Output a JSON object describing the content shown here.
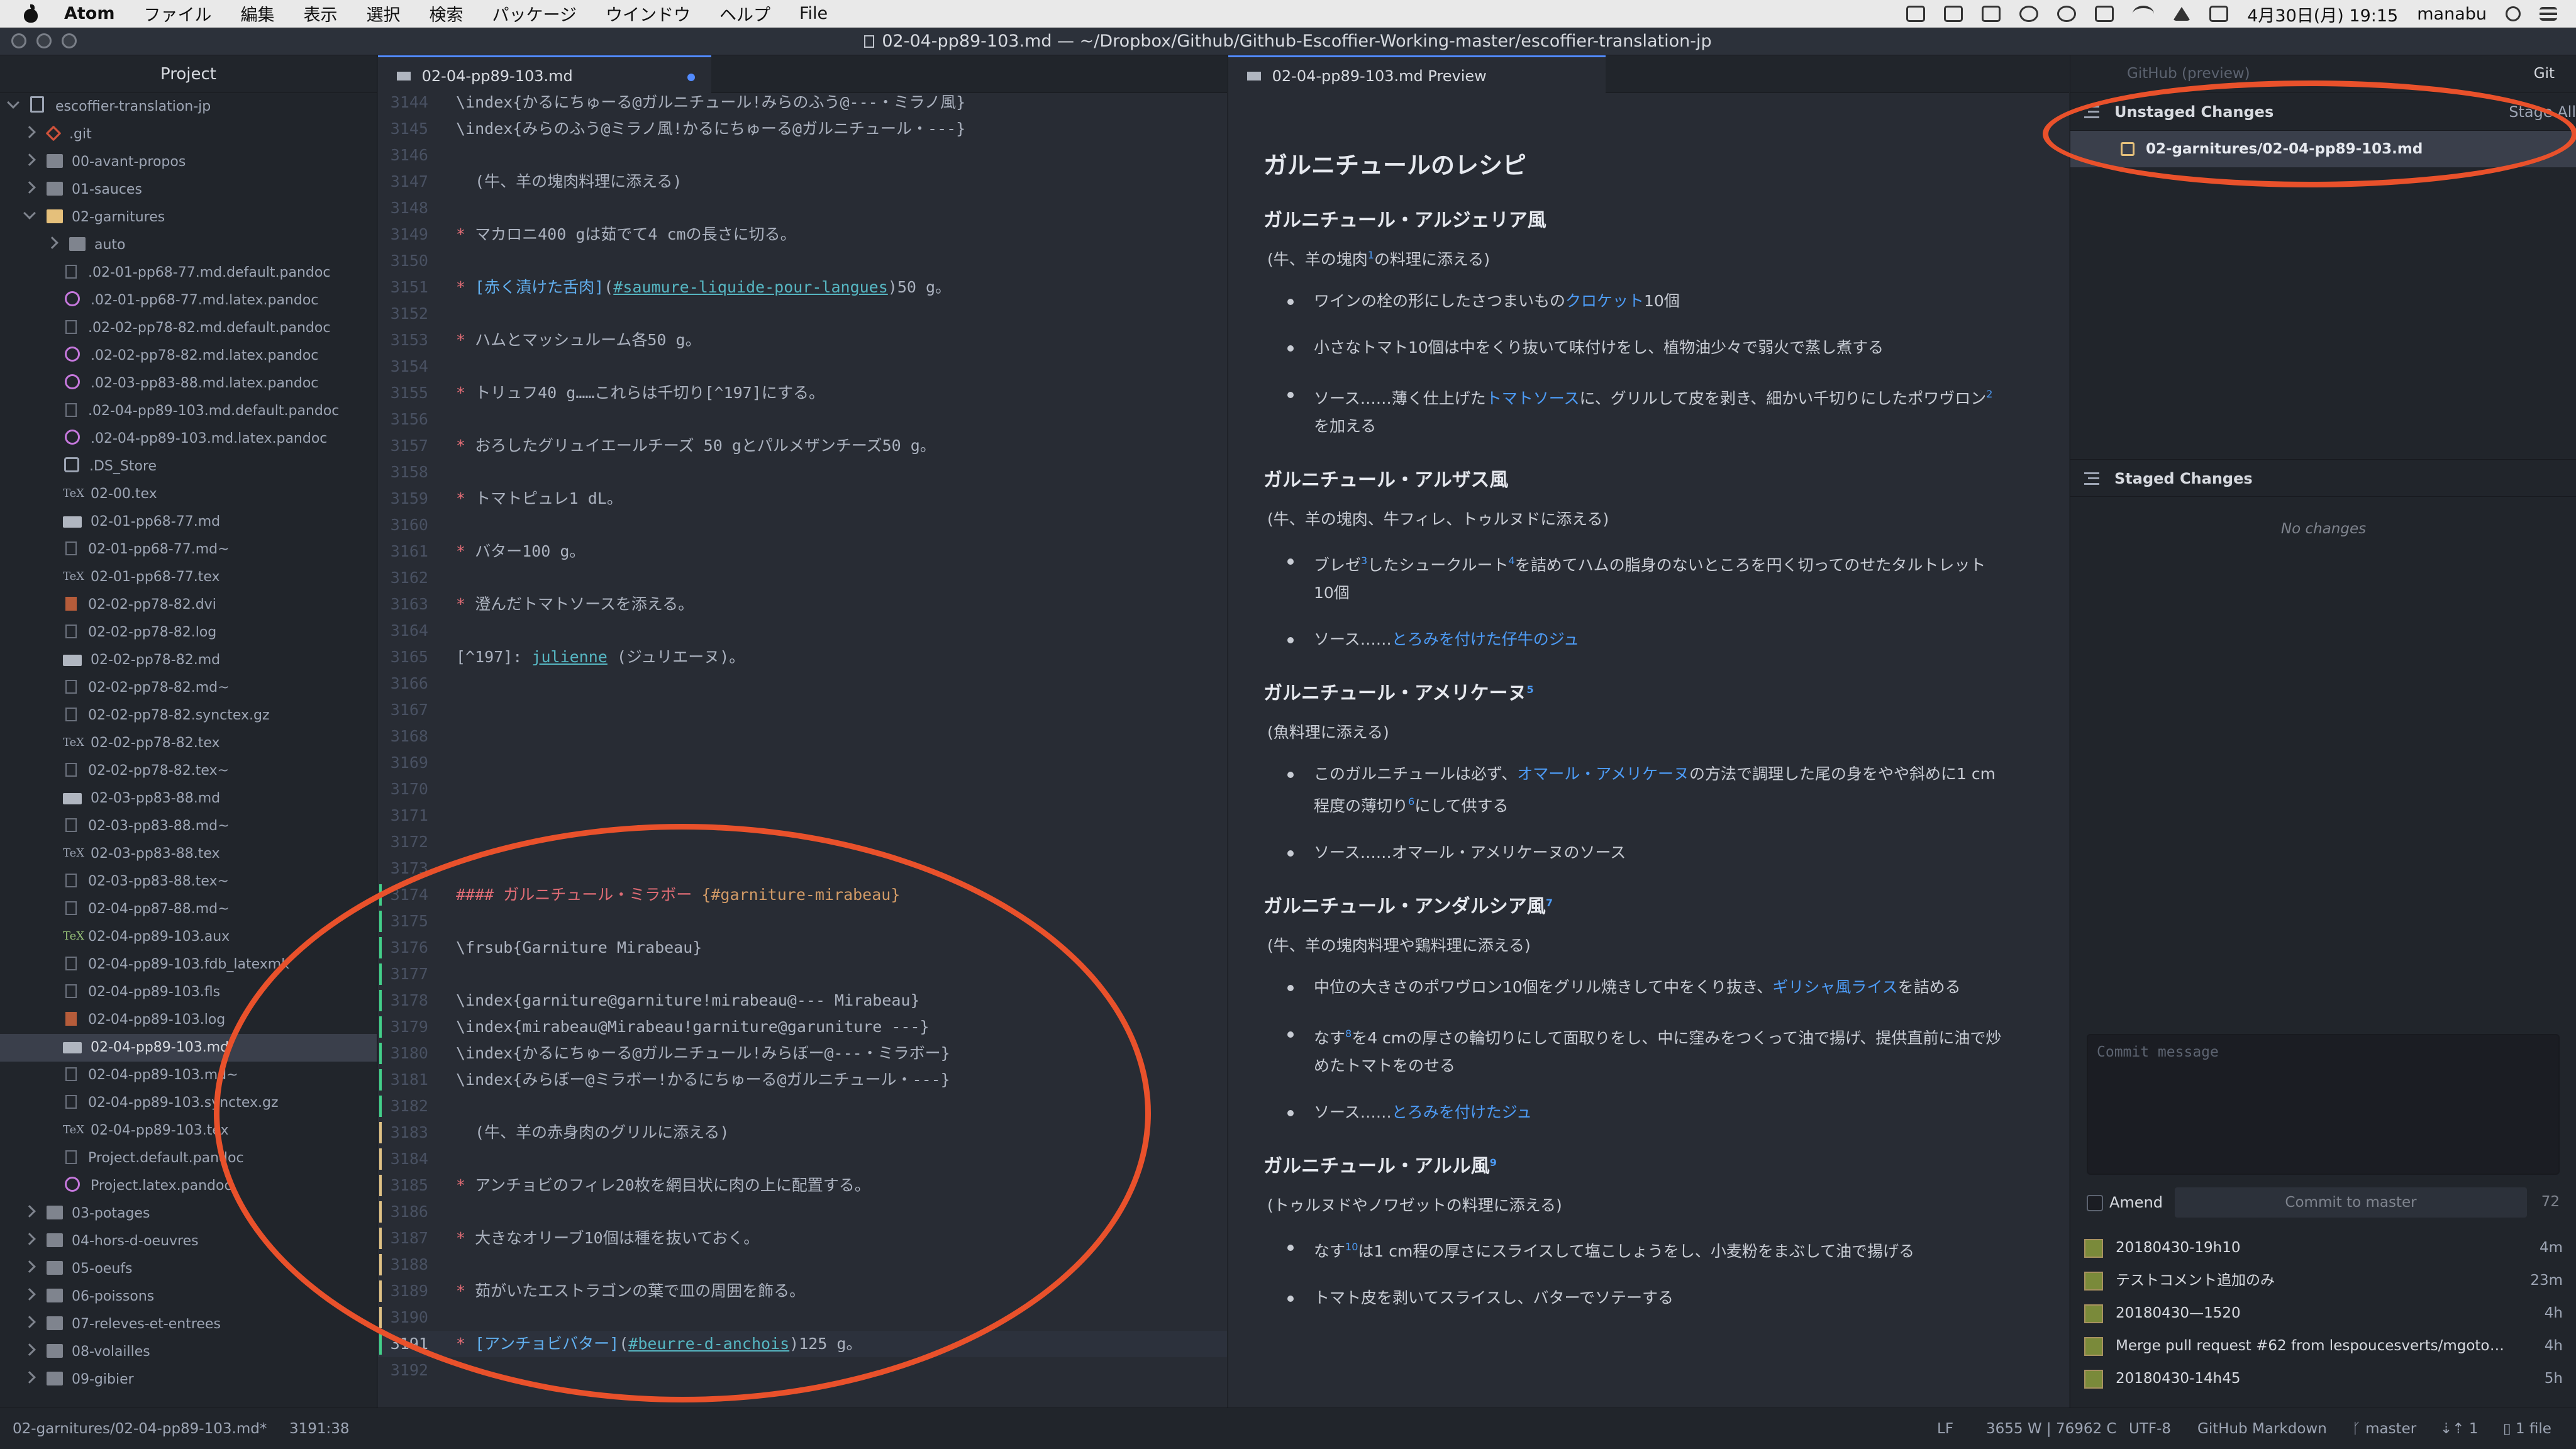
{
  "menubar": {
    "app": "Atom",
    "items": [
      "ファイル",
      "編集",
      "表示",
      "選択",
      "検索",
      "パッケージ",
      "ウインドウ",
      "ヘルプ",
      "File"
    ],
    "datetime": "4月30日(月)  19:15",
    "user": "manabu"
  },
  "window": {
    "title": "02-04-pp89-103.md — ~/Dropbox/Github/Github-Escoffier-Working-master/escoffier-translation-jp"
  },
  "tree": {
    "title": "Project",
    "items": [
      {
        "label": "escoffier-translation-jp",
        "kind": "root",
        "depth": 0,
        "chev": "open"
      },
      {
        "label": ".git",
        "kind": "git",
        "depth": 1,
        "chev": "closed"
      },
      {
        "label": "00-avant-propos",
        "kind": "folder",
        "depth": 1,
        "chev": "closed"
      },
      {
        "label": "01-sauces",
        "kind": "folder",
        "depth": 1,
        "chev": "closed"
      },
      {
        "label": "02-garnitures",
        "kind": "folder-open",
        "depth": 1,
        "chev": "open"
      },
      {
        "label": "auto",
        "kind": "folder",
        "depth": 2,
        "chev": "closed"
      },
      {
        "label": ".02-01-pp68-77.md.default.pandoc",
        "kind": "file",
        "depth": 2
      },
      {
        "label": ".02-01-pp68-77.md.latex.pandoc",
        "kind": "pandoc",
        "depth": 2
      },
      {
        "label": ".02-02-pp78-82.md.default.pandoc",
        "kind": "file",
        "depth": 2
      },
      {
        "label": ".02-02-pp78-82.md.latex.pandoc",
        "kind": "pandoc",
        "depth": 2
      },
      {
        "label": ".02-03-pp83-88.md.latex.pandoc",
        "kind": "pandoc",
        "depth": 2
      },
      {
        "label": ".02-04-pp89-103.md.default.pandoc",
        "kind": "file",
        "depth": 2
      },
      {
        "label": ".02-04-pp89-103.md.latex.pandoc",
        "kind": "pandoc",
        "depth": 2
      },
      {
        "label": ".DS_Store",
        "kind": "dsstore",
        "depth": 2
      },
      {
        "label": "02-00.tex",
        "kind": "tex",
        "depth": 2
      },
      {
        "label": "02-01-pp68-77.md",
        "kind": "md",
        "depth": 2
      },
      {
        "label": "02-01-pp68-77.md~",
        "kind": "file",
        "depth": 2
      },
      {
        "label": "02-01-pp68-77.tex",
        "kind": "tex",
        "depth": 2
      },
      {
        "label": "02-02-pp78-82.dvi",
        "kind": "log",
        "depth": 2
      },
      {
        "label": "02-02-pp78-82.log",
        "kind": "file",
        "depth": 2
      },
      {
        "label": "02-02-pp78-82.md",
        "kind": "md",
        "depth": 2
      },
      {
        "label": "02-02-pp78-82.md~",
        "kind": "file",
        "depth": 2
      },
      {
        "label": "02-02-pp78-82.synctex.gz",
        "kind": "file",
        "depth": 2
      },
      {
        "label": "02-02-pp78-82.tex",
        "kind": "tex",
        "depth": 2
      },
      {
        "label": "02-02-pp78-82.tex~",
        "kind": "file",
        "depth": 2
      },
      {
        "label": "02-03-pp83-88.md",
        "kind": "md",
        "depth": 2
      },
      {
        "label": "02-03-pp83-88.md~",
        "kind": "file",
        "depth": 2
      },
      {
        "label": "02-03-pp83-88.tex",
        "kind": "tex",
        "depth": 2
      },
      {
        "label": "02-03-pp83-88.tex~",
        "kind": "file",
        "depth": 2
      },
      {
        "label": "02-04-pp87-88.md~",
        "kind": "file",
        "depth": 2
      },
      {
        "label": "02-04-pp89-103.aux",
        "kind": "aux",
        "depth": 2
      },
      {
        "label": "02-04-pp89-103.fdb_latexmk",
        "kind": "file",
        "depth": 2
      },
      {
        "label": "02-04-pp89-103.fls",
        "kind": "file",
        "depth": 2
      },
      {
        "label": "02-04-pp89-103.log",
        "kind": "log",
        "depth": 2
      },
      {
        "label": "02-04-pp89-103.md",
        "kind": "md",
        "depth": 2,
        "selected": true
      },
      {
        "label": "02-04-pp89-103.md~",
        "kind": "file",
        "depth": 2
      },
      {
        "label": "02-04-pp89-103.synctex.gz",
        "kind": "file",
        "depth": 2
      },
      {
        "label": "02-04-pp89-103.tex",
        "kind": "tex",
        "depth": 2
      },
      {
        "label": "Project.default.pandoc",
        "kind": "file",
        "depth": 2
      },
      {
        "label": "Project.latex.pandoc",
        "kind": "pandoc",
        "depth": 2
      },
      {
        "label": "03-potages",
        "kind": "folder",
        "depth": 1,
        "chev": "closed"
      },
      {
        "label": "04-hors-d-oeuvres",
        "kind": "folder",
        "depth": 1,
        "chev": "closed"
      },
      {
        "label": "05-oeufs",
        "kind": "folder",
        "depth": 1,
        "chev": "closed"
      },
      {
        "label": "06-poissons",
        "kind": "folder",
        "depth": 1,
        "chev": "closed"
      },
      {
        "label": "07-releves-et-entrees",
        "kind": "folder",
        "depth": 1,
        "chev": "closed"
      },
      {
        "label": "08-volailles",
        "kind": "folder",
        "depth": 1,
        "chev": "closed"
      },
      {
        "label": "09-gibier",
        "kind": "folder",
        "depth": 1,
        "chev": "closed"
      }
    ]
  },
  "editor": {
    "tab_label": "02-04-pp89-103.md",
    "lines": [
      {
        "n": "3144",
        "text": "\\index{かるにちゅーる@ガルニチュール!みらのふう@---・ミラノ風}"
      },
      {
        "n": "3145",
        "text": "\\index{みらのふう@ミラノ風!かるにちゅーる@ガルニチュール・---}"
      },
      {
        "n": "3146",
        "text": ""
      },
      {
        "n": "3147",
        "text": "  (牛、羊の塊肉料理に添える)"
      },
      {
        "n": "3148",
        "text": ""
      },
      {
        "n": "3149",
        "text": "マカロニ400 gは茹でて4 cmの長さに切る。",
        "bullet": true
      },
      {
        "n": "3150",
        "text": ""
      },
      {
        "n": "3151",
        "bullet": true,
        "parts": [
          [
            "link",
            "[赤く漬けた舌肉]"
          ],
          [
            "plain",
            "("
          ],
          [
            "url",
            "#saumure-liquide-pour-langues"
          ],
          [
            "plain",
            ")50 g。"
          ]
        ]
      },
      {
        "n": "3152",
        "text": ""
      },
      {
        "n": "3153",
        "text": "ハムとマッシュルーム各50 g。",
        "bullet": true
      },
      {
        "n": "3154",
        "text": ""
      },
      {
        "n": "3155",
        "text": "トリュフ40 g……これらは千切り[^197]にする。",
        "bullet": true
      },
      {
        "n": "3156",
        "text": ""
      },
      {
        "n": "3157",
        "text": "おろしたグリュイエールチーズ 50 gとパルメザンチーズ50 g。",
        "bullet": true
      },
      {
        "n": "3158",
        "text": ""
      },
      {
        "n": "3159",
        "text": "トマトピュレ1 dL。",
        "bullet": true
      },
      {
        "n": "3160",
        "text": ""
      },
      {
        "n": "3161",
        "text": "バター100 g。",
        "bullet": true
      },
      {
        "n": "3162",
        "text": ""
      },
      {
        "n": "3163",
        "text": "澄んだトマトソースを添える。",
        "bullet": true
      },
      {
        "n": "3164",
        "text": ""
      },
      {
        "n": "3165",
        "parts": [
          [
            "plain",
            "[^197]: "
          ],
          [
            "url",
            "julienne"
          ],
          [
            "plain",
            " (ジュリエーヌ)。"
          ]
        ]
      },
      {
        "n": "3166",
        "text": ""
      },
      {
        "n": "3167",
        "text": ""
      },
      {
        "n": "3168",
        "text": ""
      },
      {
        "n": "3169",
        "text": ""
      },
      {
        "n": "3170",
        "text": ""
      },
      {
        "n": "3171",
        "text": ""
      },
      {
        "n": "3172",
        "text": ""
      },
      {
        "n": "3173",
        "text": ""
      },
      {
        "n": "3174",
        "parts": [
          [
            "head",
            "#### ガルニチュール・ミラボー "
          ],
          [
            "anchor",
            "{#garniture-mirabeau}"
          ]
        ],
        "mark": "added"
      },
      {
        "n": "3175",
        "text": "",
        "mark": "added"
      },
      {
        "n": "3176",
        "text": "\\frsub{Garniture Mirabeau}",
        "mark": "added"
      },
      {
        "n": "3177",
        "text": "",
        "mark": "added"
      },
      {
        "n": "3178",
        "text": "\\index{garniture@garniture!mirabeau@--- Mirabeau}",
        "mark": "added"
      },
      {
        "n": "3179",
        "text": "\\index{mirabeau@Mirabeau!garniture@garuniture ---}",
        "mark": "added"
      },
      {
        "n": "3180",
        "text": "\\index{かるにちゅーる@ガルニチュール!みらぼー@---・ミラボー}",
        "mark": "added"
      },
      {
        "n": "3181",
        "text": "\\index{みらぼー@ミラボー!かるにちゅーる@ガルニチュール・---}",
        "mark": "added"
      },
      {
        "n": "3182",
        "text": "",
        "mark": "added"
      },
      {
        "n": "3183",
        "text": "  (牛、羊の赤身肉のグリルに添える)",
        "mark": "modified"
      },
      {
        "n": "3184",
        "text": "",
        "mark": "modified"
      },
      {
        "n": "3185",
        "text": "アンチョビのフィレ20枚を網目状に肉の上に配置する。",
        "bullet": true,
        "mark": "modified"
      },
      {
        "n": "3186",
        "text": "",
        "mark": "modified"
      },
      {
        "n": "3187",
        "text": "大きなオリーブ10個は種を抜いておく。",
        "bullet": true,
        "mark": "modified"
      },
      {
        "n": "3188",
        "text": "",
        "mark": "modified"
      },
      {
        "n": "3189",
        "text": "茹がいたエストラゴンの葉で皿の周囲を飾る。",
        "bullet": true,
        "mark": "modified"
      },
      {
        "n": "3190",
        "text": "",
        "mark": "modified"
      },
      {
        "n": "3191",
        "bullet": true,
        "cursor": true,
        "mark": "added",
        "parts": [
          [
            "link",
            "[アンチョビバター]"
          ],
          [
            "plain",
            "("
          ],
          [
            "url",
            "#beurre-d-anchois"
          ],
          [
            "plain",
            ")125 g。"
          ]
        ]
      },
      {
        "n": "3192",
        "text": ""
      }
    ]
  },
  "preview": {
    "tab_label": "02-04-pp89-103.md Preview",
    "heading": "ガルニチュールのレシピ",
    "sections": [
      {
        "title": "ガルニチュール・アルジェリア風",
        "title_sup": "",
        "note": [
          [
            "t",
            "(牛、羊の塊肉"
          ],
          [
            "sup",
            "1"
          ],
          [
            "t",
            "の料理に添える)"
          ]
        ],
        "items": [
          [
            [
              "t",
              "ワインの栓の形にしたさつまいもの"
            ],
            [
              "a",
              "クロケット"
            ],
            [
              "t",
              "10個"
            ]
          ],
          [
            [
              "t",
              "小さなトマト10個は中をくり抜いて味付けをし、植物油少々で弱火で蒸し煮する"
            ]
          ],
          [
            [
              "t",
              "ソース……薄く仕上げた"
            ],
            [
              "a",
              "トマトソース"
            ],
            [
              "t",
              "に、グリルして皮を剥き、細かい千切りにしたポワヴロン"
            ],
            [
              "sup",
              "2"
            ],
            [
              "t",
              "を加える"
            ]
          ]
        ]
      },
      {
        "title": "ガルニチュール・アルザス風",
        "title_sup": "",
        "note": [
          [
            "t",
            "(牛、羊の塊肉、牛フィレ、トゥルヌドに添える)"
          ]
        ],
        "items": [
          [
            [
              "t",
              "ブレゼ"
            ],
            [
              "sup",
              "3"
            ],
            [
              "t",
              "したシュークルート"
            ],
            [
              "sup",
              "4"
            ],
            [
              "t",
              "を詰めてハムの脂身のないところを円く切ってのせたタルトレット10個"
            ]
          ],
          [
            [
              "t",
              "ソース……"
            ],
            [
              "a",
              "とろみを付けた仔牛のジュ"
            ]
          ]
        ]
      },
      {
        "title": "ガルニチュール・アメリケーヌ",
        "title_sup": "5",
        "note": [
          [
            "t",
            "(魚料理に添える)"
          ]
        ],
        "items": [
          [
            [
              "t",
              "このガルニチュールは必ず、"
            ],
            [
              "a",
              "オマール・アメリケーヌ"
            ],
            [
              "t",
              "の方法で調理した尾の身をやや斜めに1 cm程度の薄切り"
            ],
            [
              "sup",
              "6"
            ],
            [
              "t",
              "にして供する"
            ]
          ],
          [
            [
              "t",
              "ソース……オマール・アメリケーヌのソース"
            ]
          ]
        ]
      },
      {
        "title": "ガルニチュール・アンダルシア風",
        "title_sup": "7",
        "note": [
          [
            "t",
            "(牛、羊の塊肉料理や鶏料理に添える)"
          ]
        ],
        "items": [
          [
            [
              "t",
              "中位の大きさのポワヴロン10個をグリル焼きして中をくり抜き、"
            ],
            [
              "a",
              "ギリシャ風ライス"
            ],
            [
              "t",
              "を詰める"
            ]
          ],
          [
            [
              "t",
              "なす"
            ],
            [
              "sup",
              "8"
            ],
            [
              "t",
              "を4 cmの厚さの輪切りにして面取りをし、中に窪みをつくって油で揚げ、提供直前に油で炒めたトマトをのせる"
            ]
          ],
          [
            [
              "t",
              "ソース……"
            ],
            [
              "a",
              "とろみを付けたジュ"
            ]
          ]
        ]
      },
      {
        "title": "ガルニチュール・アルル風",
        "title_sup": "9",
        "note": [
          [
            "t",
            "(トゥルヌドやノワゼットの料理に添える)"
          ]
        ],
        "items": [
          [
            [
              "t",
              "なす"
            ],
            [
              "sup",
              "10"
            ],
            [
              "t",
              "は1 cm程の厚さにスライスして塩こしょうをし、小麦粉をまぶして油で揚げる"
            ]
          ],
          [
            [
              "t",
              "トマト皮を剥いてスライスし、バターでソテーする"
            ]
          ]
        ]
      }
    ]
  },
  "git": {
    "tab_github": "GitHub (preview)",
    "tab_git": "Git",
    "unstaged_title": "Unstaged Changes",
    "stage_all": "Stage All",
    "unstaged_file": "02-garnitures/02-04-pp89-103.md",
    "staged_title": "Staged Changes",
    "no_changes": "No changes",
    "commit_placeholder": "Commit message",
    "amend": "Amend",
    "commit_button": "Commit to master",
    "commit_count": "72",
    "recent": [
      {
        "msg": "20180430-19h10",
        "when": "4m"
      },
      {
        "msg": "テストコメント追加のみ",
        "when": "23m"
      },
      {
        "msg": "20180430—1520",
        "when": "4h"
      },
      {
        "msg": "Merge pull request #62 from lespoucesverts/mgoto-2018...",
        "when": "4h"
      },
      {
        "msg": "20180430-14h45",
        "when": "5h"
      }
    ]
  },
  "status": {
    "path": "02-garnitures/02-04-pp89-103.md*",
    "cursor": "3191:38",
    "eol": "LF",
    "counts": "3655 W | 76962 C",
    "encoding": "UTF-8",
    "grammar": "GitHub Markdown",
    "branch": "master",
    "fetch": "1",
    "files": "1 file"
  },
  "colors": {
    "annotation": "#e9512b",
    "accent": "#528bff",
    "link": "#4d9cf7",
    "added": "#43d08a",
    "modified": "#e0c285"
  }
}
